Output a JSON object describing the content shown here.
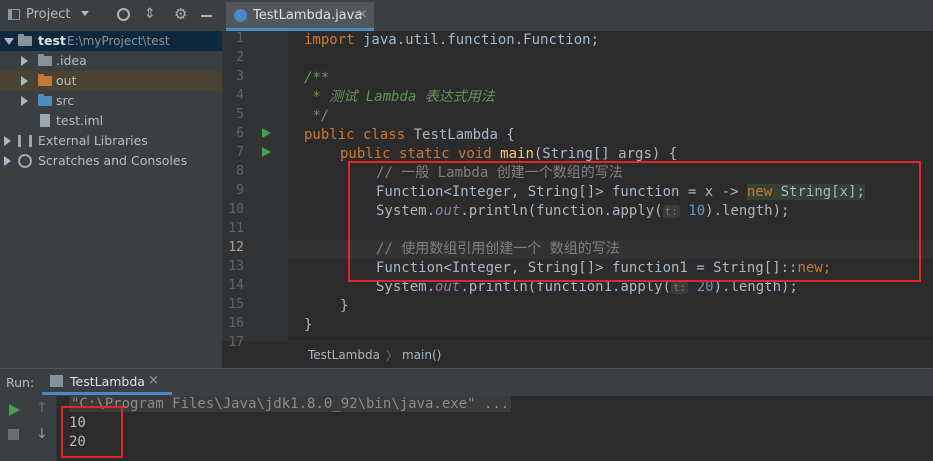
{
  "project_panel": {
    "title": "Project",
    "tree": [
      {
        "label": "test",
        "path": "E:\\myProject\\test"
      },
      {
        "label": ".idea"
      },
      {
        "label": "out"
      },
      {
        "label": "src"
      },
      {
        "label": "test.iml"
      },
      {
        "label": "External Libraries"
      },
      {
        "label": "Scratches and Consoles"
      }
    ]
  },
  "editor": {
    "tab_label": "TestLambda.java",
    "line_numbers": [
      "1",
      "2",
      "3",
      "4",
      "5",
      "6",
      "7",
      "8",
      "9",
      "10",
      "11",
      "12",
      "13",
      "14",
      "15",
      "16",
      "17"
    ],
    "code": {
      "l1_import": "import",
      "l1_rest": " java.util.function.Function;",
      "l4": "/**",
      "l5": " * 测试 Lambda 表达式用法",
      "l6": " */",
      "l6_public": "public",
      "l6_class": " class",
      "l6_name": " TestLambda {",
      "l7_mods": "public static void",
      "l7_main": "main",
      "l7_rest": "(String[] args) {",
      "l8": "// 一般 Lambda 创建一个数组的写法",
      "l9_a": "Function<Integer, String[]> function = x -> ",
      "l9_new": "new",
      "l9_b": " String[x];",
      "l10_a": "System.",
      "l10_out": "out",
      "l10_b": ".println(function.apply(",
      "l10_hint": "t:",
      "l10_num": " 10",
      "l10_c": ").length);",
      "l12": "// 使用数组引用创建一个 数组的写法",
      "l13_a": "Function<Integer, String[]> function1 = String[]::",
      "l13_new": "new",
      "l13_b": ";",
      "l14_a": "System.",
      "l14_out": "out",
      "l14_b": ".println(function1.apply(",
      "l14_hint": "t:",
      "l14_num": " 20",
      "l14_c": ").length);",
      "l15": "}",
      "l16": "}"
    },
    "breadcrumb": [
      "TestLambda",
      "main()"
    ]
  },
  "run_panel": {
    "label": "Run:",
    "tab_label": "TestLambda",
    "command": "\"C:\\Program Files\\Java\\jdk1.8.0_92\\bin\\java.exe\" ...",
    "output": [
      "10",
      "20"
    ]
  },
  "colors": {
    "background": "#2b2b2b",
    "keyword": "#cc7832",
    "comment": "#808080",
    "highlight_box": "#e0262d"
  }
}
